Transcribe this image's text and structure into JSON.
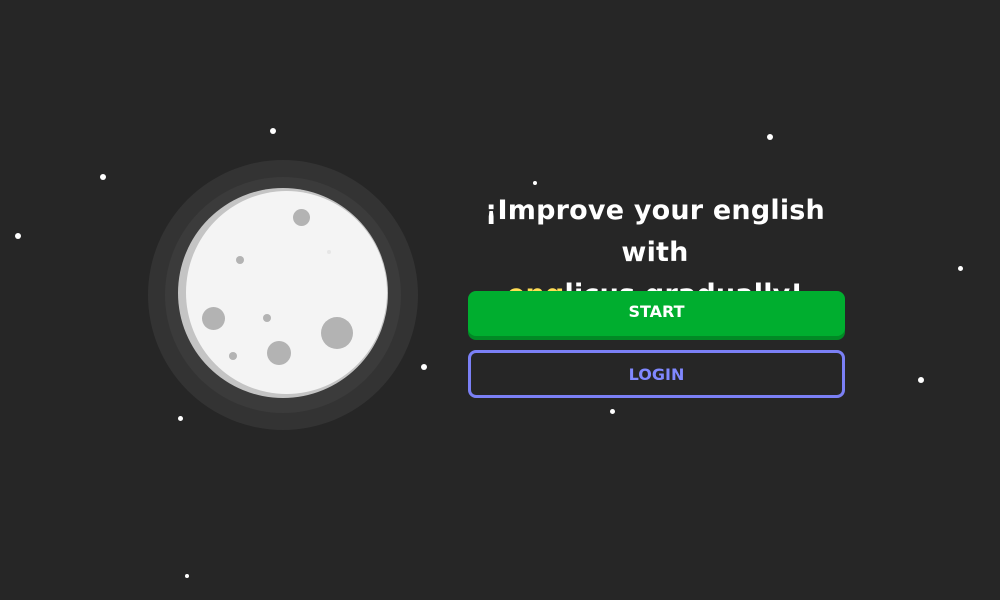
{
  "headline": {
    "line1": "¡Improve your english with",
    "brand_highlight": "eng",
    "brand_rest": "licus",
    "line2_rest": " gradually!"
  },
  "buttons": {
    "start_label": "START",
    "login_label": "LOGIN"
  },
  "colors": {
    "background": "#262626",
    "brand_highlight": "#ffdd55",
    "start_button": "#00ae2f",
    "login_border": "#7b80f5"
  }
}
